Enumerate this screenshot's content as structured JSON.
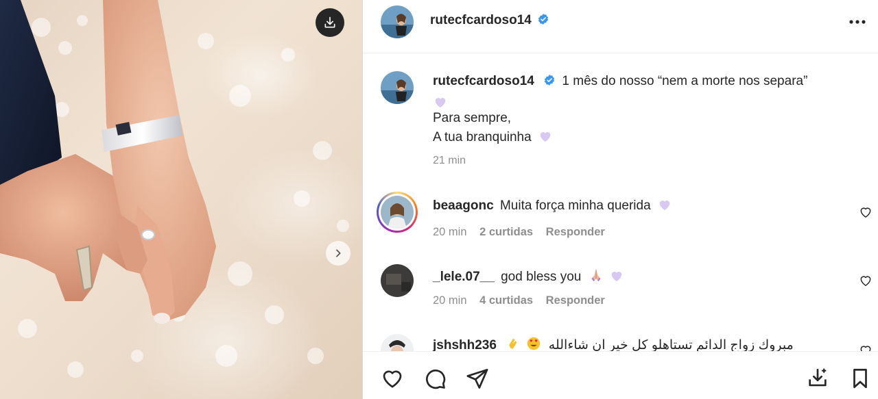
{
  "post": {
    "author": "rutecfcardoso14",
    "caption_line1": "1 mês do nosso “nem a morte nos separa”",
    "caption_line2": "Para sempre,",
    "caption_line3": "A tua branquinha",
    "time": "21 min"
  },
  "comments": [
    {
      "user": "beaagonc",
      "text": "Muita força minha querida",
      "time": "20 min",
      "likes": "2 curtidas",
      "reply": "Responder",
      "has_story": true
    },
    {
      "user": "_lele.07__",
      "text": "god bless you",
      "time": "20 min",
      "likes": "4 curtidas",
      "reply": "Responder",
      "has_story": false
    },
    {
      "user": "jshshh236",
      "text": "مبروك زواج الدائم تستاهلو كل خير ان شاءالله",
      "has_story": false
    }
  ],
  "icons": {
    "download": "download-icon",
    "next": "chevron-right-icon",
    "more": "more-options-icon",
    "verified": "verified-badge-icon",
    "like": "heart-icon",
    "comment": "comment-icon",
    "share": "send-icon",
    "save_download": "download-tray-icon",
    "bookmark": "bookmark-icon"
  },
  "colors": {
    "verified": "#3897f0",
    "text": "#262626",
    "muted": "#8e8e8e",
    "divider": "#dbdbdb"
  }
}
